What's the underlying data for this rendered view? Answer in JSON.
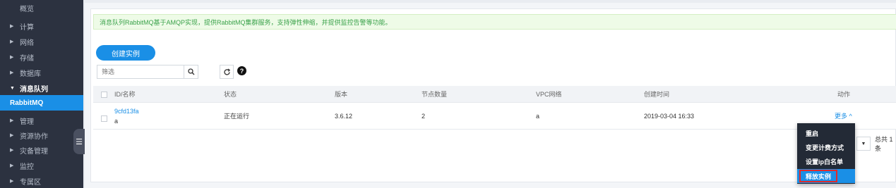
{
  "sidebar": {
    "items": [
      {
        "label": "概览",
        "arrow": ""
      },
      {
        "label": "计算",
        "arrow": "▶"
      },
      {
        "label": "网络",
        "arrow": "▶"
      },
      {
        "label": "存储",
        "arrow": "▶"
      },
      {
        "label": "数据库",
        "arrow": "▶"
      },
      {
        "label": "消息队列",
        "arrow": "▼"
      },
      {
        "label": "RabbitMQ",
        "arrow": ""
      },
      {
        "label": "管理",
        "arrow": "▶"
      },
      {
        "label": "资源协作",
        "arrow": "▶"
      },
      {
        "label": "灾备管理",
        "arrow": "▶"
      },
      {
        "label": "监控",
        "arrow": "▶"
      },
      {
        "label": "专属区",
        "arrow": "▶"
      }
    ],
    "collapse_glyph": "☰"
  },
  "notice": {
    "text": "消息队列RabbitMQ基于AMQP实现，提供RabbitMQ集群服务，支持弹性伸缩，并提供监控告警等功能。"
  },
  "toolbar": {
    "create_label": "创建实例",
    "filter_placeholder": "筛选",
    "search_glyph": "🔍",
    "refresh_glyph": "↻",
    "help_glyph": "?"
  },
  "table": {
    "headers": {
      "name": "ID/名称",
      "status": "状态",
      "version": "版本",
      "nodes": "节点数量",
      "vpc": "VPC网络",
      "created": "创建时间",
      "actions": "动作"
    },
    "rows": [
      {
        "id": "9cfd13fa",
        "name": "a",
        "status": "正在运行",
        "version": "3.6.12",
        "nodes": "2",
        "vpc": "a",
        "created": "2019-03-04 16:33",
        "more": "更多 ^"
      }
    ]
  },
  "pager": {
    "dropdown_glyph": "▼",
    "total_text": "总共 1 条"
  },
  "dropdown_menu": {
    "items": [
      "重启",
      "变更计费方式",
      "设置ip白名单",
      "释放实例"
    ]
  },
  "colors": {
    "accent": "#1a8fe6",
    "sidebar_bg": "#2c3240",
    "notice_text": "#3aa24a",
    "highlight_border": "#e02a2a"
  }
}
